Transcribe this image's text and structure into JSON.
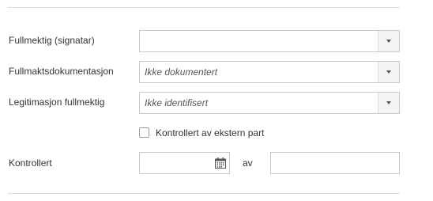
{
  "form": {
    "fields": [
      {
        "label": "Fullmektig (signatar)",
        "value": ""
      },
      {
        "label": "Fullmaktsdokumentasjon",
        "value": "Ikke dokumentert"
      },
      {
        "label": "Legitimasjon fullmektig",
        "value": "Ikke identifisert"
      }
    ],
    "checkbox": {
      "label": "Kontrollert av ekstern part",
      "checked": false
    },
    "controlled": {
      "label": "Kontrollert",
      "date_value": "",
      "by_label": "av",
      "by_value": ""
    }
  },
  "icons": {
    "dropdown": "chevron-down-icon",
    "calendar": "calendar-icon"
  },
  "colors": {
    "border": "#c8c8c8",
    "divider": "#d9d9d9",
    "text": "#333333"
  }
}
